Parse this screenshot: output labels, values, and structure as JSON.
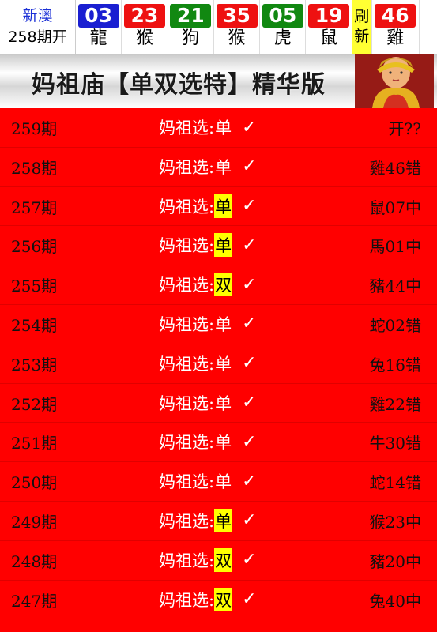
{
  "header": {
    "region": "新澳",
    "issue": "258期开",
    "balls": [
      {
        "num": "03",
        "zodiac": "龍",
        "color": "#1a1fd1"
      },
      {
        "num": "23",
        "zodiac": "猴",
        "color": "#ee1111"
      },
      {
        "num": "21",
        "zodiac": "狗",
        "color": "#118811"
      },
      {
        "num": "35",
        "zodiac": "猴",
        "color": "#ee1111"
      },
      {
        "num": "05",
        "zodiac": "虎",
        "color": "#118811"
      },
      {
        "num": "19",
        "zodiac": "鼠",
        "color": "#ee1111"
      }
    ],
    "refresh_top": "刷",
    "refresh_bottom": "新",
    "special": {
      "num": "46",
      "zodiac": "雞",
      "color": "#ee1111"
    }
  },
  "banner": {
    "title": "妈祖庙【单双选特】精华版"
  },
  "pick_label": "妈祖选:",
  "check_mark": "✓",
  "rows": [
    {
      "period": "259期",
      "pick": "单",
      "highlight": false,
      "result": "开??"
    },
    {
      "period": "258期",
      "pick": "单",
      "highlight": false,
      "result": "雞46错"
    },
    {
      "period": "257期",
      "pick": "单",
      "highlight": true,
      "result": "鼠07中"
    },
    {
      "period": "256期",
      "pick": "单",
      "highlight": true,
      "result": "馬01中"
    },
    {
      "period": "255期",
      "pick": "双",
      "highlight": true,
      "result": "豬44中"
    },
    {
      "period": "254期",
      "pick": "单",
      "highlight": false,
      "result": "蛇02错"
    },
    {
      "period": "253期",
      "pick": "单",
      "highlight": false,
      "result": "兔16错"
    },
    {
      "period": "252期",
      "pick": "单",
      "highlight": false,
      "result": "雞22错"
    },
    {
      "period": "251期",
      "pick": "单",
      "highlight": false,
      "result": "牛30错"
    },
    {
      "period": "250期",
      "pick": "单",
      "highlight": false,
      "result": "蛇14错"
    },
    {
      "period": "249期",
      "pick": "单",
      "highlight": true,
      "result": "猴23中"
    },
    {
      "period": "248期",
      "pick": "双",
      "highlight": true,
      "result": "豬20中"
    },
    {
      "period": "247期",
      "pick": "双",
      "highlight": true,
      "result": "兔40中"
    }
  ]
}
